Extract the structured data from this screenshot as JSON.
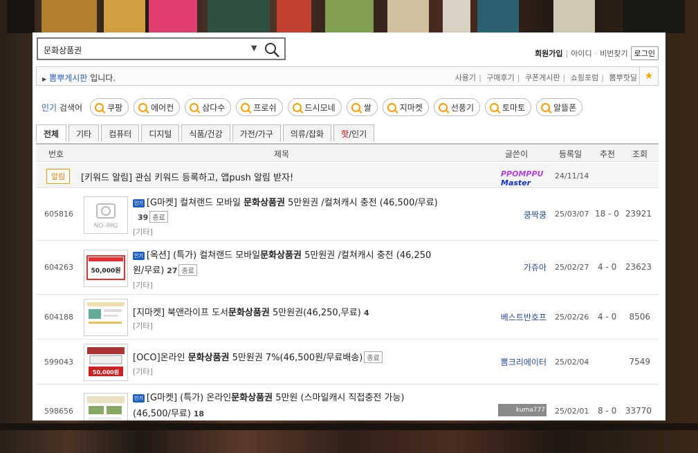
{
  "search": {
    "value": "문화상품권"
  },
  "toplinks": {
    "signup": "회원가입",
    "id": "아이디",
    "pw": "비번찾기",
    "login": "로그인"
  },
  "crumb": {
    "board": "뽐뿌게시판",
    "suffix": "입니다.",
    "links": [
      "사용기",
      "구매후기",
      "쿠폰게시판",
      "쇼핑포럼",
      "뽐뿌핫딜"
    ]
  },
  "popular": {
    "label_hl": "인기",
    "label": "검색어",
    "items": [
      "쿠팡",
      "에어컨",
      "삼다수",
      "프로쉬",
      "드시모네",
      "쌀",
      "지마켓",
      "선풍기",
      "토마토",
      "알뜰폰"
    ]
  },
  "tabs": [
    "전체",
    "기타",
    "컴퓨터",
    "디지털",
    "식품/건강",
    "가전/가구",
    "의류/잡화"
  ],
  "tab_hot": {
    "a": "핫",
    "b": "/인기"
  },
  "headers": {
    "num": "번호",
    "title": "제목",
    "author": "글쓴이",
    "date": "등록일",
    "rec": "추천",
    "views": "조회"
  },
  "notice": {
    "badge": "알림",
    "title": "[키워드 알림] 관심 키워드 등록하고, 앱push 알림 받자!",
    "author1": "PPOMPPU",
    "author2": "Master",
    "date": "24/11/14"
  },
  "ui": {
    "hot_badge": "인기",
    "noimg": "NO-IMG",
    "thumb_price": "50,000원"
  },
  "rows": [
    {
      "num": "605816",
      "pre": "[G마켓] 컬쳐랜드 모바일 ",
      "bold": "문화상품권",
      "post": " 5만원권 /컬쳐캐시 충전 (46,500/무료)",
      "cmt": "39",
      "end": "종료",
      "cat": "[기타]",
      "author": "쿵짝쿵",
      "date": "25/03/07",
      "rec": "18 - 0",
      "views": "23921"
    },
    {
      "num": "604263",
      "pre": "[옥션] (특가) 컬쳐랜드 모바일",
      "bold": "문화상품권",
      "post": " 5만원권 /컬쳐캐시 충전 (46,250",
      "line2": "원/무료)",
      "cmt": "27",
      "end": "종료",
      "cat": "[기타]",
      "author": "가쥬아",
      "date": "25/02/27",
      "rec": "4 - 0",
      "views": "23623"
    },
    {
      "num": "604188",
      "pre": "[지마켓] 북앤라이프 도서",
      "bold": "문화상품권",
      "post": " 5만원권(46,250,무료)",
      "cmt": "4",
      "cat": "[기타]",
      "author": "베스트반호프",
      "date": "25/02/26",
      "rec": "4 - 0",
      "views": "8506"
    },
    {
      "num": "599043",
      "pre": "[OCO]온라인 ",
      "bold": "문화상품권",
      "post": " 5만원권 7%(46,500원/무료배송)",
      "end": "종료",
      "cat": "[기타]",
      "author": "뽐크리에이터",
      "date": "25/02/04",
      "views": "7549"
    },
    {
      "num": "598656",
      "pre": "[G마켓] (특가) 온라인",
      "bold": "문화상품권",
      "post": " 5만원 (스마일캐시 직접충전 가능)",
      "line2": "(46,500/무료)",
      "cmt": "18",
      "author": "kuma777",
      "date": "25/02/01",
      "rec": "8 - 0",
      "views": "33770"
    }
  ]
}
